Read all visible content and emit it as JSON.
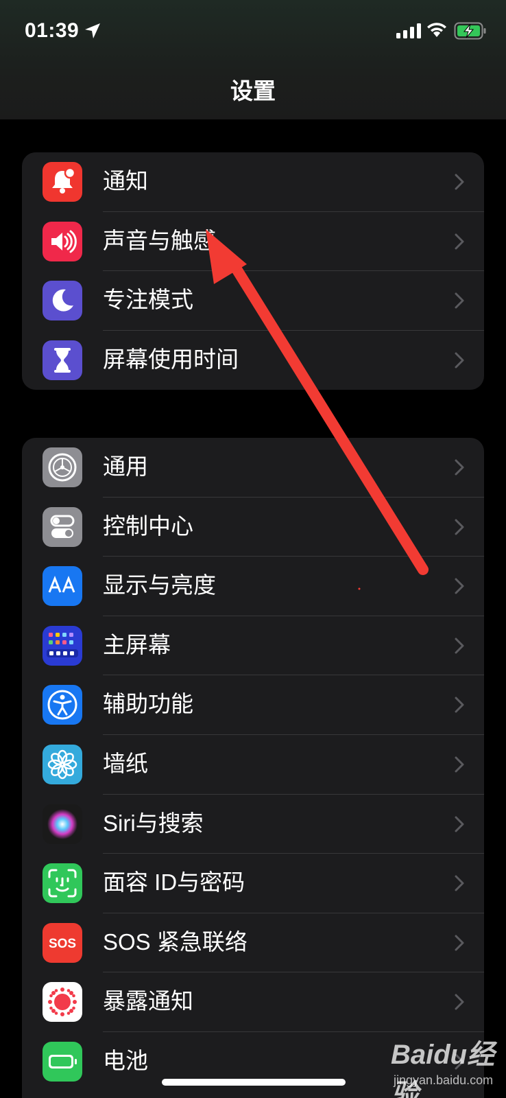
{
  "status_bar": {
    "time": "01:39",
    "icons": [
      "location-arrow-icon",
      "cellular-signal-icon",
      "wifi-icon",
      "battery-charging-icon"
    ]
  },
  "nav": {
    "title": "设置"
  },
  "group1": [
    {
      "label": "通知",
      "icon": "notifications-icon",
      "color": "#f0362f"
    },
    {
      "label": "声音与触感",
      "icon": "sound-icon",
      "color": "#f0284a"
    },
    {
      "label": "专注模式",
      "icon": "moon-icon",
      "color": "#5b4fcf"
    },
    {
      "label": "屏幕使用时间",
      "icon": "hourglass-icon",
      "color": "#5b4fcf"
    }
  ],
  "group2": [
    {
      "label": "通用",
      "icon": "gear-icon",
      "color": "#8e8e93"
    },
    {
      "label": "控制中心",
      "icon": "toggle-icon",
      "color": "#8e8e93"
    },
    {
      "label": "显示与亮度",
      "icon": "aa-display-icon",
      "color": "#1877f2"
    },
    {
      "label": "主屏幕",
      "icon": "home-screen-icon",
      "color": "#2a3bd3"
    },
    {
      "label": "辅助功能",
      "icon": "accessibility-icon",
      "color": "#1877f2"
    },
    {
      "label": "墙纸",
      "icon": "flower-icon",
      "color": "#34aadc"
    },
    {
      "label": "Siri与搜索",
      "icon": "siri-icon",
      "color": "#1a1a1a"
    },
    {
      "label": "面容 ID与密码",
      "icon": "face-id-icon",
      "color": "#30c75a"
    },
    {
      "label": "SOS 紧急联络",
      "icon": "sos-icon",
      "color": "#ee3a30"
    },
    {
      "label": "暴露通知",
      "icon": "exposure-icon",
      "color": "#ffffff"
    },
    {
      "label": "电池",
      "icon": "battery-icon",
      "color": "#30c75a"
    }
  ],
  "annotation": {
    "color": "#f23b33"
  },
  "watermark": {
    "text": "Baidu经验",
    "url": "jingyan.baidu.com"
  }
}
